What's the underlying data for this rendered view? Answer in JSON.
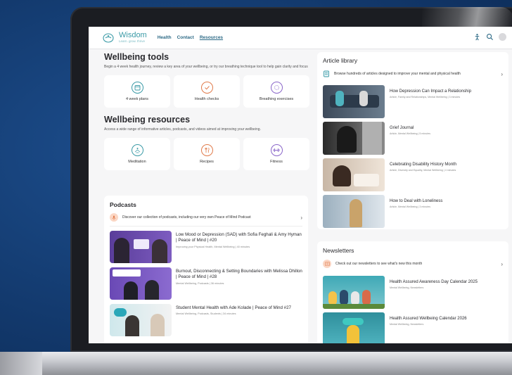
{
  "header": {
    "logo_name": "Wisdom",
    "logo_tagline": "Learn. grow. thrive",
    "nav": [
      "Health",
      "Contact",
      "Resources"
    ],
    "active_nav": "Resources"
  },
  "tools": {
    "title": "Wellbeing tools",
    "description": "Begin a 4 week health journey, review a key area of your wellbeing, or try our breathing technique tool to help gain clarity and focus",
    "items": [
      {
        "label": "4 week plans",
        "icon": "calendar-icon",
        "color": "#3a9aa6"
      },
      {
        "label": "Health checks",
        "icon": "check-icon",
        "color": "#e07a4a"
      },
      {
        "label": "Breathing exercises",
        "icon": "breath-icon",
        "color": "#8a66c9"
      }
    ]
  },
  "resources": {
    "title": "Wellbeing resources",
    "description": "Access a wide range of informative articles, podcasts, and videos aimed at improving your wellbeing.",
    "items": [
      {
        "label": "Meditation",
        "icon": "meditation-icon",
        "color": "#3a9aa6"
      },
      {
        "label": "Recipes",
        "icon": "recipes-icon",
        "color": "#e07a4a"
      },
      {
        "label": "Fitness",
        "icon": "fitness-icon",
        "color": "#8a66c9"
      }
    ]
  },
  "podcasts": {
    "title": "Podcasts",
    "intro": "Discover our collection of podcasts, including our very own Peace of Mind Podcast",
    "items": [
      {
        "title": "Low Mood or Depression (SAD) with Sofia Feghali & Amy Hyman | Peace of Mind | #20",
        "meta": "Improving your Physical Health, Mental Wellbeing | 40 minutes"
      },
      {
        "title": "Burnout, Disconnecting & Setting Boundaries with Melissa Dhillon | Peace of Mind | #28",
        "meta": "Mental Wellbeing, Podcasts | 36 minutes"
      },
      {
        "title": "Student Mental Health with Ade Kolade | Peace of Mind #27",
        "meta": "Mental Wellbeing, Podcasts, Students | 34 minutes"
      }
    ]
  },
  "articles": {
    "title": "Article library",
    "intro": "Browse hundreds of articles designed to improve your mental and physical health",
    "items": [
      {
        "title": "How Depression Can Impact a Relationship",
        "meta": "Article, Family and Relationships, Mental Wellbeing | 3 minutes"
      },
      {
        "title": "Grief Journal",
        "meta": "Article, Mental Wellbeing | 5 minutes"
      },
      {
        "title": "Celebrating Disability History Month",
        "meta": "Article, Diversity and Equality, Mental Wellbeing | 4 minutes"
      },
      {
        "title": "How to Deal with Loneliness",
        "meta": "Article, Mental Wellbeing | 3 minutes"
      }
    ]
  },
  "newsletters": {
    "title": "Newsletters",
    "intro": "Check out our newsletters to see what's new this month",
    "items": [
      {
        "title": "Health Assured Awareness Day Calendar 2025",
        "meta": "Mental Wellbeing, Newsletters"
      },
      {
        "title": "Health Assured Wellbeing Calendar 2026",
        "meta": "Mental Wellbeing, Newsletters"
      }
    ]
  },
  "colors": {
    "teal": "#3a9aa6",
    "orange": "#e07a4a",
    "purple": "#8a66c9",
    "background": "#12386b"
  }
}
